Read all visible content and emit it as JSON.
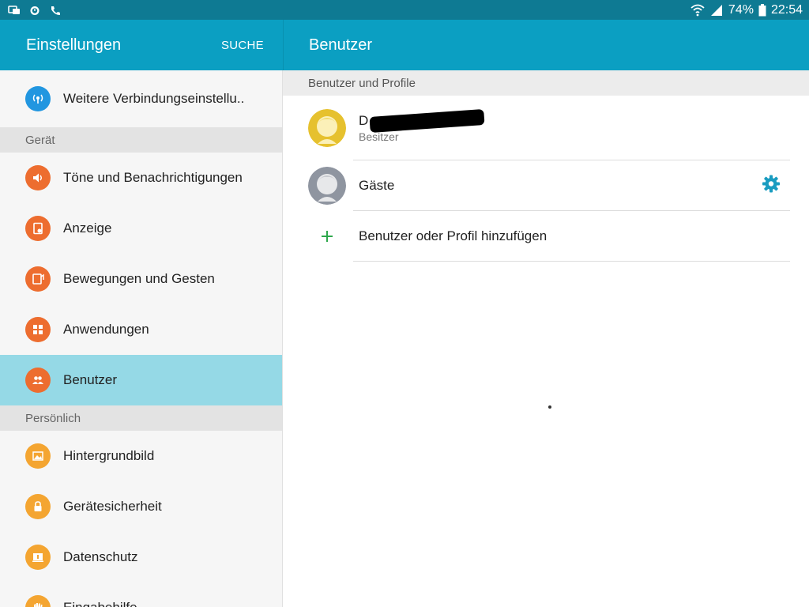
{
  "status_bar": {
    "battery_percent": "74%",
    "time": "22:54",
    "icons": [
      "notification-icon",
      "alarm-icon",
      "phone-icon",
      "wifi-icon",
      "signal-icon",
      "battery-icon"
    ]
  },
  "left_appbar": {
    "title": "Einstellungen",
    "search_label": "SUCHE"
  },
  "right_appbar": {
    "title": "Benutzer"
  },
  "sidebar": {
    "items": [
      {
        "label": "Weitere Verbindungseinstellu..",
        "icon": "network-icon",
        "color": "#2196e0"
      },
      {
        "section": "Gerät"
      },
      {
        "label": "Töne und Benachrichtigungen",
        "icon": "sound-icon",
        "color": "#ed6d2f"
      },
      {
        "label": "Anzeige",
        "icon": "display-icon",
        "color": "#ed6d2f"
      },
      {
        "label": "Bewegungen und Gesten",
        "icon": "motion-icon",
        "color": "#ed6d2f"
      },
      {
        "label": "Anwendungen",
        "icon": "apps-icon",
        "color": "#ed6d2f"
      },
      {
        "label": "Benutzer",
        "icon": "users-icon",
        "color": "#ed6d2f",
        "active": true
      },
      {
        "section": "Persönlich"
      },
      {
        "label": "Hintergrundbild",
        "icon": "wallpaper-icon",
        "color": "#f4a531"
      },
      {
        "label": "Gerätesicherheit",
        "icon": "lock-icon",
        "color": "#f4a531"
      },
      {
        "label": "Datenschutz",
        "icon": "privacy-icon",
        "color": "#f4a531"
      },
      {
        "label": "Eingabehilfe",
        "icon": "accessibility-icon",
        "color": "#f4a531"
      }
    ]
  },
  "main": {
    "section_title": "Benutzer und Profile",
    "owner": {
      "name_prefix": "D",
      "role": "Besitzer"
    },
    "guest": {
      "name": "Gäste"
    },
    "add_user": {
      "label": "Benutzer oder Profil hinzufügen"
    }
  },
  "colors": {
    "status_bar": "#0e7a93",
    "app_bar": "#0b9fc2",
    "active_item": "#95d9e6",
    "gear": "#1a9cc0",
    "plus": "#2ea84c"
  }
}
